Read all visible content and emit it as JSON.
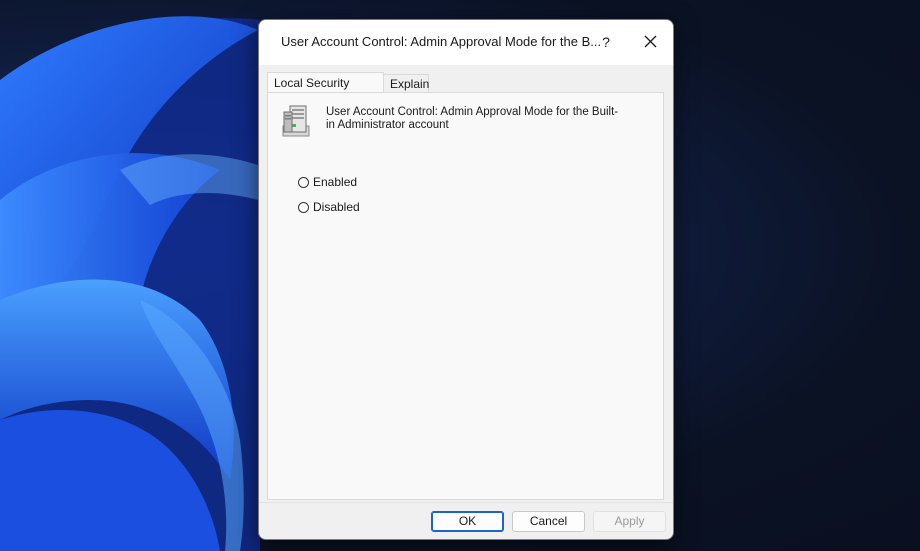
{
  "dialog": {
    "title": "User Account Control: Admin Approval Mode for the B...",
    "help_glyph": "?",
    "close_glyph": "close"
  },
  "tabs": [
    {
      "label": "Local Security Setting",
      "active": true
    },
    {
      "label": "Explain",
      "active": false
    }
  ],
  "policy": {
    "icon": "server-policy-icon",
    "title": "User Account Control: Admin Approval Mode for the Built-in Administrator account"
  },
  "options": [
    {
      "label": "Enabled",
      "selected": false
    },
    {
      "label": "Disabled",
      "selected": false
    }
  ],
  "buttons": {
    "ok": "OK",
    "cancel": "Cancel",
    "apply": "Apply"
  },
  "colors": {
    "accent": "#1a66c2",
    "desktop_bg": "#0b1224",
    "wallpaper_blue": "#1f5fe6"
  }
}
